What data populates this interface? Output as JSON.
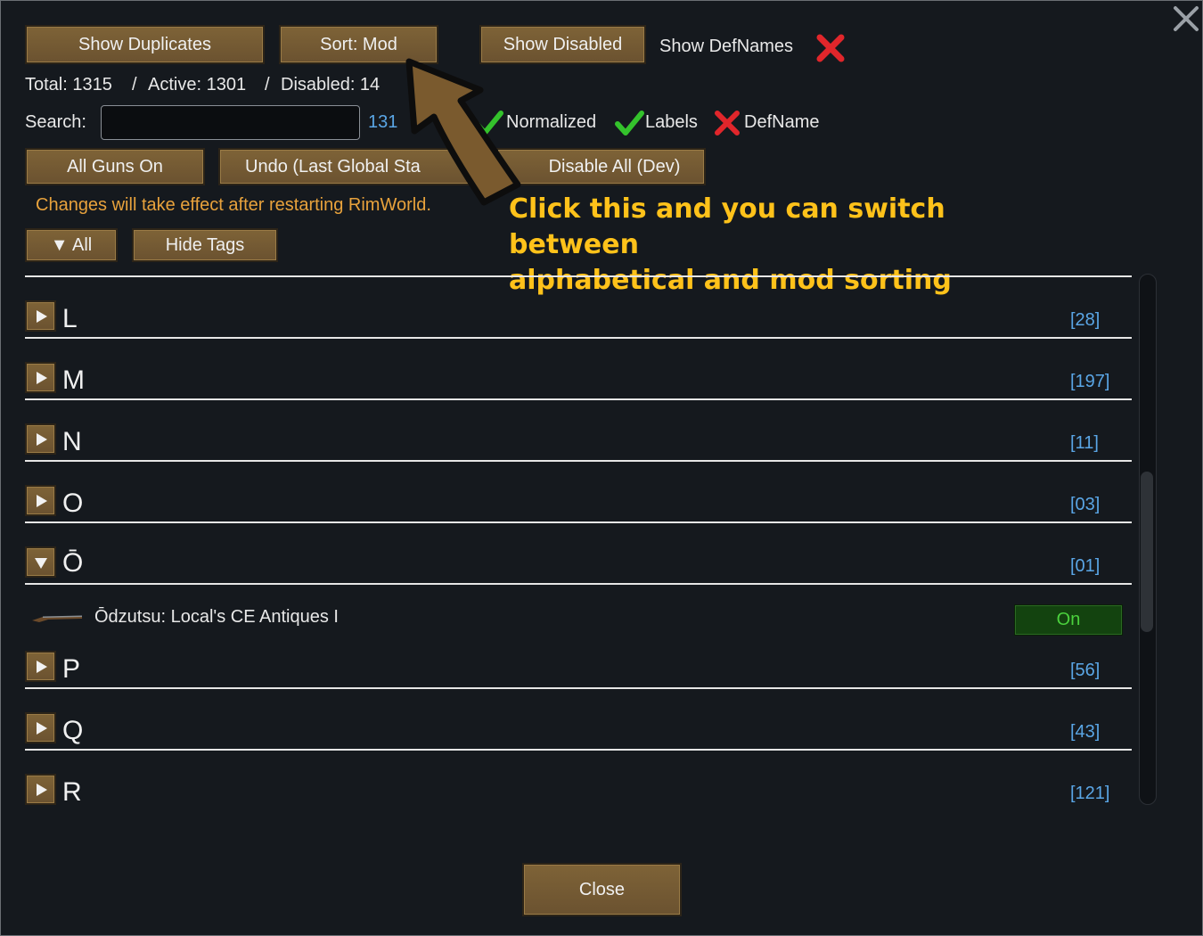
{
  "toolbar": {
    "show_duplicates": "Show Duplicates",
    "sort": "Sort: Mod",
    "show_disabled": "Show Disabled",
    "show_defnames_label": "Show DefNames"
  },
  "stats": {
    "total": "Total: 1315",
    "sep1": "/",
    "active": "Active: 1301",
    "sep2": "/",
    "disabled": "Disabled: 14"
  },
  "search": {
    "label": "Search:",
    "value": "",
    "result_count": "131",
    "filters": [
      {
        "label": "Normalized",
        "state": "check"
      },
      {
        "label": "Labels",
        "state": "check"
      },
      {
        "label": "DefName",
        "state": "cross"
      }
    ]
  },
  "actions": {
    "all_guns_on": "All Guns On",
    "undo": "Undo (Last Global Sta",
    "disable_all": "Disable All (Dev)"
  },
  "notice": "Changes will take effect after restarting RimWorld.",
  "filter_bar": {
    "all": "▼ All",
    "hide_tags": "Hide Tags"
  },
  "annotation": {
    "line1": "Click this and you can switch between",
    "line2": "alphabetical and mod sorting"
  },
  "groups": [
    {
      "letter": "L",
      "count": "[28]",
      "expanded": false
    },
    {
      "letter": "M",
      "count": "[197]",
      "expanded": false
    },
    {
      "letter": "N",
      "count": "[11]",
      "expanded": false
    },
    {
      "letter": "O",
      "count": "[03]",
      "expanded": false
    },
    {
      "letter": "Ō",
      "count": "[01]",
      "expanded": true
    },
    {
      "letter": "P",
      "count": "[56]",
      "expanded": false
    },
    {
      "letter": "Q",
      "count": "[43]",
      "expanded": false
    },
    {
      "letter": "R",
      "count": "[121]",
      "expanded": false
    }
  ],
  "expanded_item": {
    "label": "Ōdzutsu: Local's CE Antiques I",
    "toggle": "On",
    "icon": "musket-icon"
  },
  "footer": {
    "close": "Close"
  },
  "colors": {
    "button": "#7e6337",
    "count": "#5aa6e6",
    "notice": "#e8a23c",
    "annotation": "#ffc21a",
    "on_toggle": "#13430f"
  }
}
